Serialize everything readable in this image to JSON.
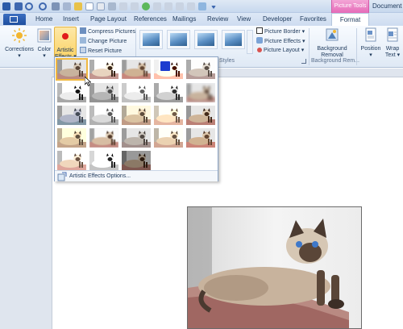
{
  "title_bar": {
    "context_tab_group": "Picture Tools",
    "document_title": "Document"
  },
  "tabs": [
    {
      "label": "Home"
    },
    {
      "label": "Insert"
    },
    {
      "label": "Page Layout"
    },
    {
      "label": "References"
    },
    {
      "label": "Mailings"
    },
    {
      "label": "Review"
    },
    {
      "label": "View"
    },
    {
      "label": "Developer"
    },
    {
      "label": "Favorites"
    },
    {
      "label": "Format"
    }
  ],
  "ribbon": {
    "adjust": {
      "corrections": "Corrections",
      "color": "Color",
      "artistic_effects_line1": "Artistic",
      "artistic_effects_line2": "Effects ▾",
      "compress": "Compress Pictures",
      "change": "Change Picture",
      "reset": "Reset Picture"
    },
    "picture_styles": {
      "border": "Picture Border ▾",
      "effects": "Picture Effects ▾",
      "layout": "Picture Layout ▾",
      "group_label": "Styles"
    },
    "background_removal": {
      "button_line1": "Background",
      "button_line2": "Removal",
      "group_label": "Background Rem..."
    },
    "arrange": {
      "position": "Position",
      "wrap_line1": "Wrap",
      "wrap_line2": "Text ▾"
    }
  },
  "gallery": {
    "footer": "Artistic Effects Options..."
  },
  "colors": {
    "context_tab": "#e56ab8",
    "ribbon_bg": "#dfe9f5",
    "selection": "#f0b840"
  }
}
